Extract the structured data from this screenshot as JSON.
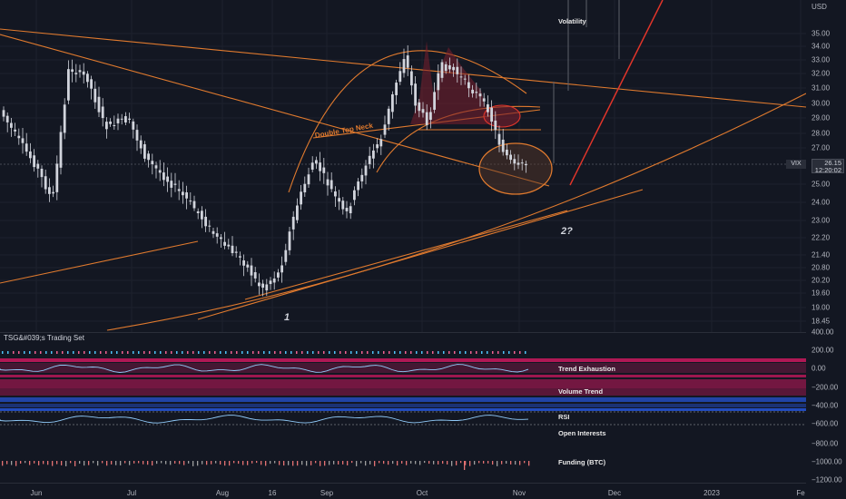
{
  "price_axis": {
    "currency": "USD",
    "labels": [
      "35.00",
      "34.00",
      "33.00",
      "32.00",
      "31.00",
      "30.00",
      "29.00",
      "28.00",
      "27.00",
      "25.00",
      "24.00",
      "23.00",
      "22.20",
      "21.40",
      "20.80",
      "20.20",
      "19.60",
      "19.00",
      "18.45"
    ]
  },
  "current_price": {
    "symbol": "VIX",
    "value": "26.15",
    "countdown": "12:20:02"
  },
  "indicator_axis": {
    "labels": [
      "400.00",
      "200.00",
      "0.00",
      "−200.00",
      "−400.00",
      "−600.00",
      "−800.00",
      "−1000.00",
      "−1200.00"
    ]
  },
  "study": {
    "title": "TSG&#039;s Trading Set",
    "labels": [
      "Volatility",
      "Trend Exhaustion",
      "Volume Trend",
      "RSI",
      "Open Interests",
      "Funding (BTC)"
    ]
  },
  "time_axis": {
    "labels": [
      "Jun",
      "Jul",
      "Aug",
      "16",
      "Sep",
      "Oct",
      "Nov",
      "Dec",
      "2023",
      "Fe"
    ]
  },
  "annotations": {
    "double_top_neck": "Double Top Neck",
    "wave1": "1",
    "wave2": "2?"
  },
  "colors": {
    "background": "#131722",
    "drawing_orange": "#e07a2e",
    "drawing_red": "#e0352b",
    "candle": "#d1d4dc",
    "indicator_magenta": "#c2185b",
    "indicator_blue": "#2962ff"
  }
}
